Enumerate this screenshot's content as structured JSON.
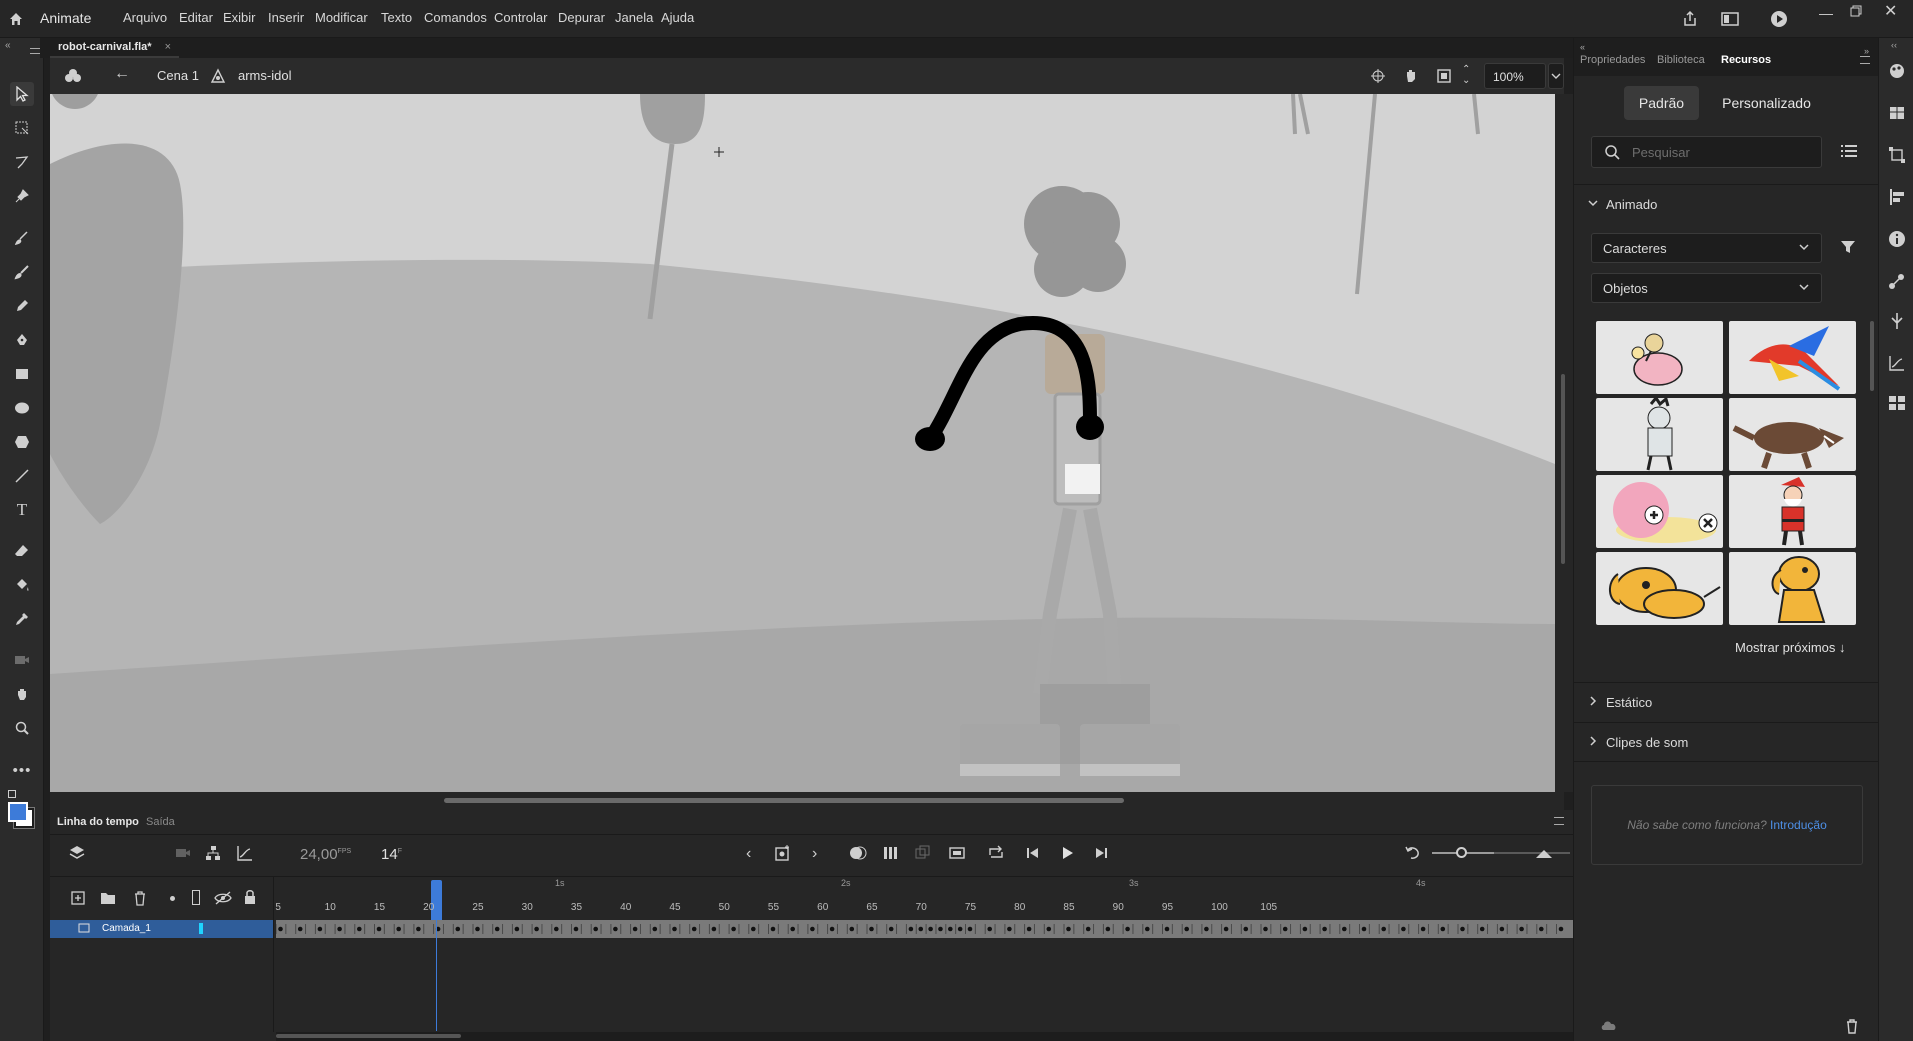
{
  "app": {
    "name": "Animate"
  },
  "menu": [
    "Arquivo",
    "Editar",
    "Exibir",
    "Inserir",
    "Modificar",
    "Texto",
    "Comandos",
    "Controlar",
    "Depurar",
    "Janela",
    "Ajuda"
  ],
  "document": {
    "tab_title": "robot-carnival.fla*",
    "close": "×"
  },
  "editbar": {
    "scene": "Cena 1",
    "symbol": "arms-idol",
    "zoom": "100%"
  },
  "timeline": {
    "tabs": [
      "Linha do tempo",
      "Saída"
    ],
    "fps": "24,00",
    "fps_unit": "FPS",
    "frame": "14",
    "frame_unit": "F",
    "layer_name": "Camada_1",
    "seconds_labels": [
      "1s",
      "2s",
      "3s",
      "4s"
    ],
    "frame_numbers": [
      "5",
      "10",
      "15",
      "20",
      "25",
      "30",
      "35",
      "40",
      "45",
      "50",
      "55",
      "60",
      "65",
      "70",
      "75",
      "80",
      "85",
      "90",
      "95",
      "100",
      "105"
    ]
  },
  "right_panel": {
    "tabs": [
      "Propriedades",
      "Biblioteca",
      "Recursos"
    ],
    "active_tab": "Recursos",
    "segment": {
      "default": "Padrão",
      "custom": "Personalizado"
    },
    "search_placeholder": "Pesquisar",
    "animated_section": "Animado",
    "dropdown_characters": "Caracteres",
    "dropdown_objects": "Objetos",
    "show_more": "Mostrar próximos",
    "static_section": "Estático",
    "sound_section": "Clipes de som",
    "help_text": "Não sabe como funciona?",
    "help_link": "Introdução"
  },
  "colors": {
    "accent": "#3d7bd9",
    "stage": "#8f8f8f",
    "panel": "#262626",
    "selected_layer": "#2f5d9a"
  }
}
